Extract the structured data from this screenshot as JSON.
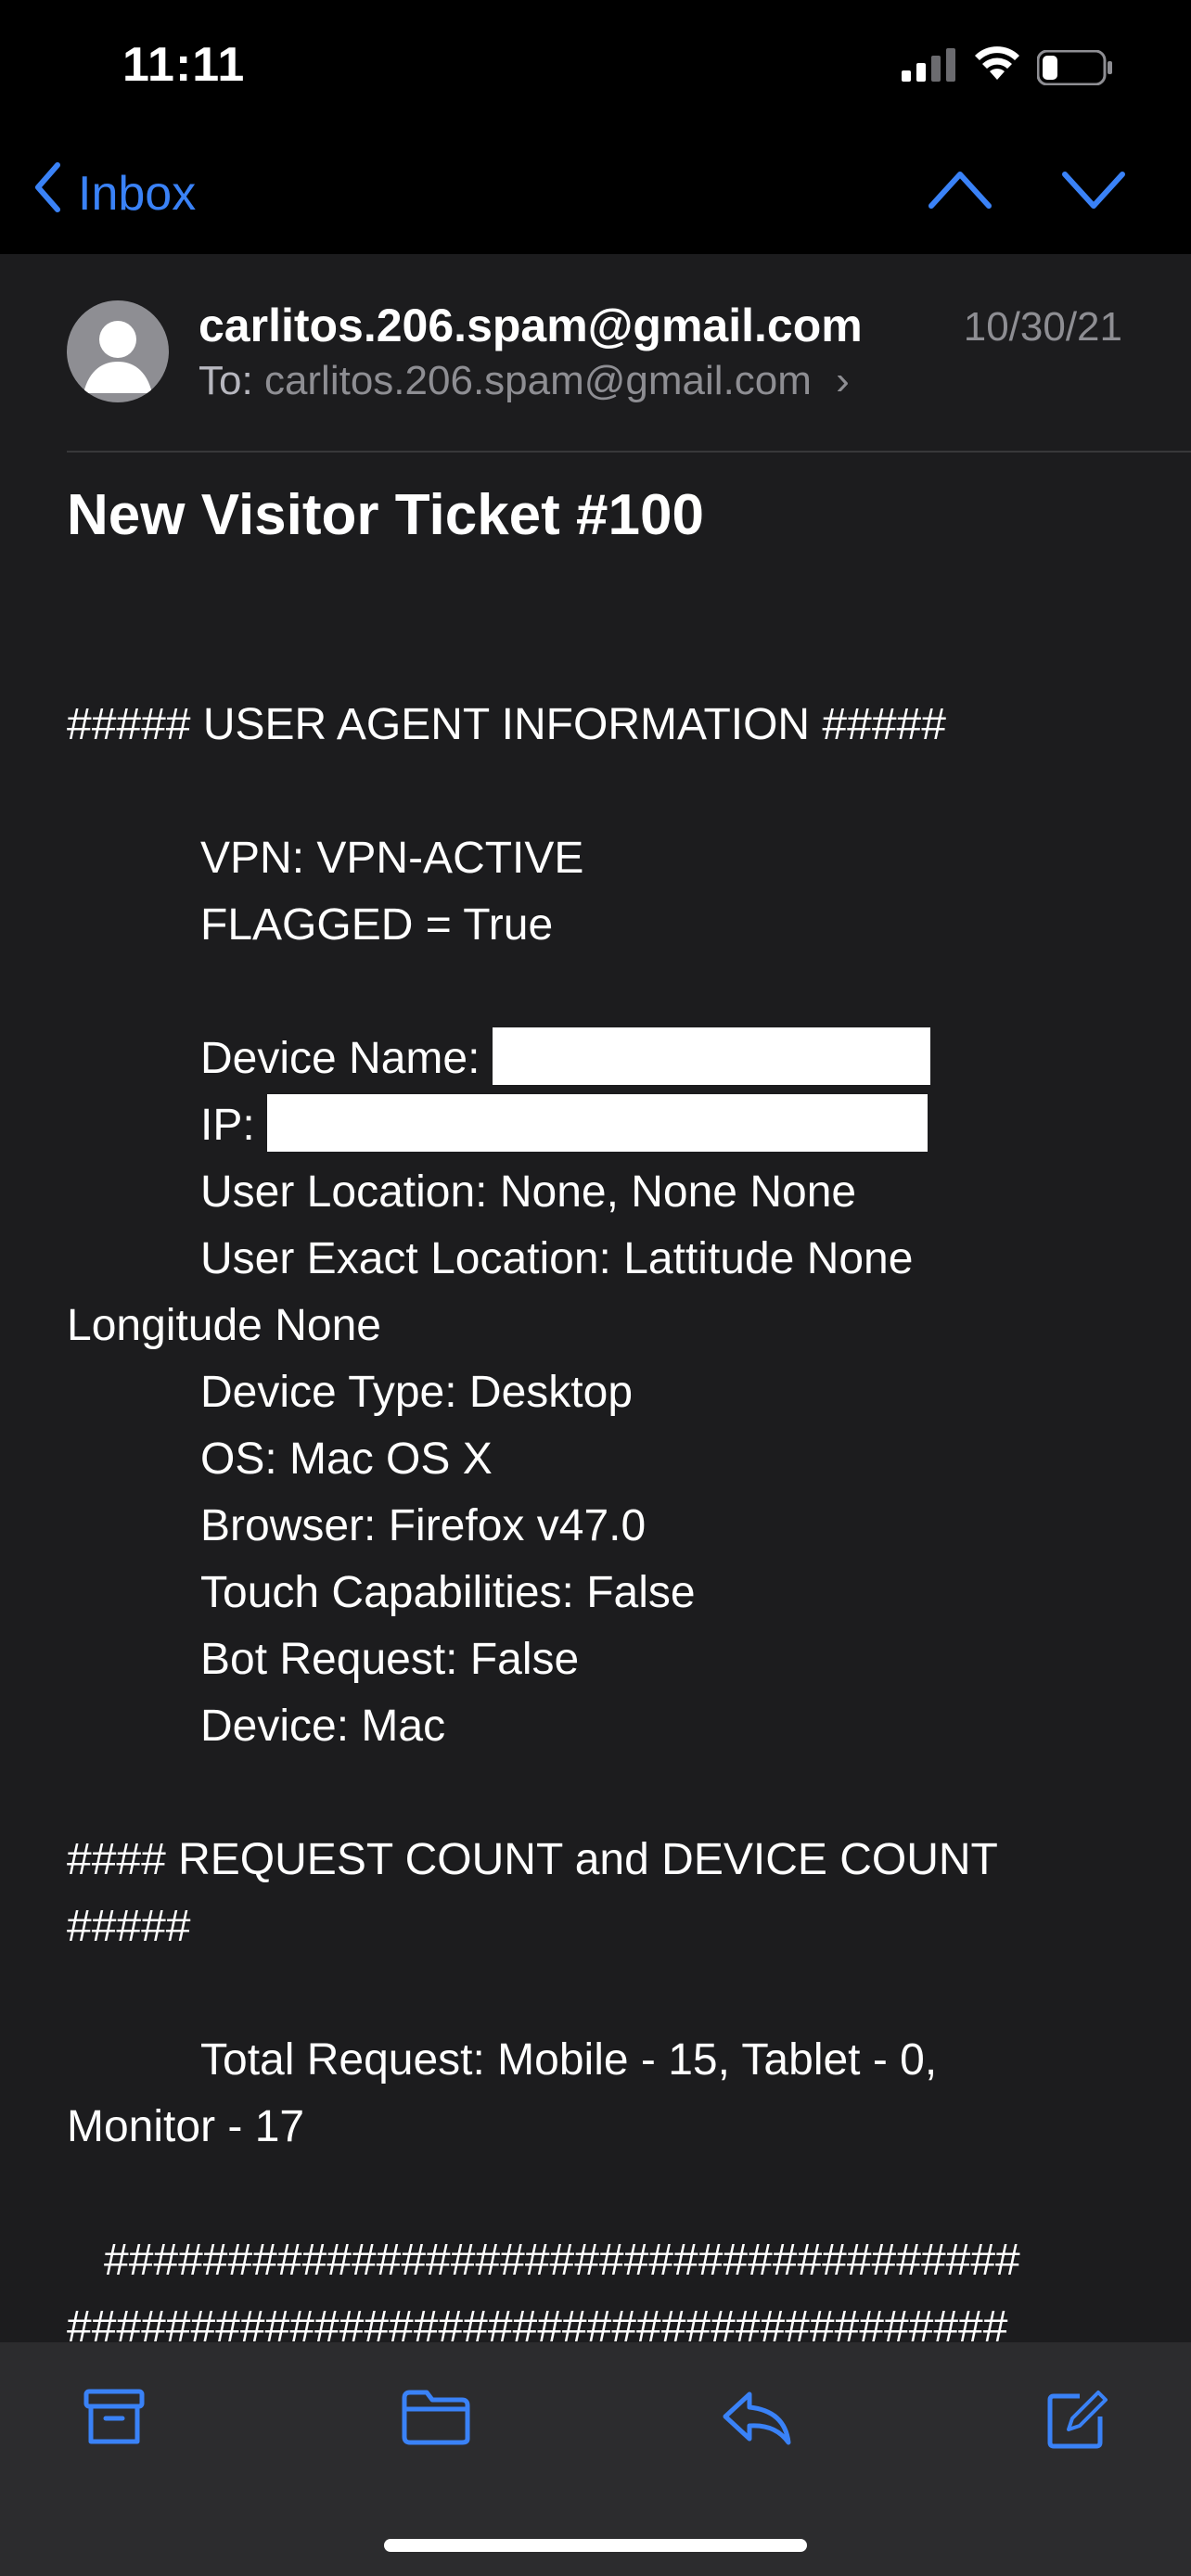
{
  "status": {
    "time": "11:11",
    "icons": [
      "signal-icon",
      "wifi-icon",
      "battery-icon"
    ]
  },
  "nav": {
    "back_label": "Inbox",
    "icons": [
      "chevron-left-icon",
      "chevron-up-icon",
      "chevron-down-icon"
    ]
  },
  "header": {
    "sender": "carlitos.206.spam@gmail.com",
    "to_label": "To:",
    "to_address": "carlitos.206.spam@gmail.com",
    "to_chevron": "›",
    "date": "10/30/21"
  },
  "email": {
    "subject": "New Visitor Ticket #100",
    "lines": {
      "ua_header": "##### USER AGENT INFORMATION #####",
      "vpn": "VPN: VPN-ACTIVE",
      "flagged": "FLAGGED = True",
      "device_name": "Device Name:",
      "ip": "IP:",
      "user_location": "User Location: None, None None",
      "exact_location_1": "User Exact Location: Lattitude None",
      "exact_location_2": "Longitude None",
      "device_type": "Device Type: Desktop",
      "os": "OS: Mac OS X",
      "browser": "Browser: Firefox v47.0",
      "touch": "Touch Capabilities: False",
      "bot": "Bot Request: False",
      "device": "Device: Mac",
      "count_header_1": "#### REQUEST COUNT and DEVICE COUNT",
      "count_header_2": "#####",
      "total_request_1": "Total Request: Mobile - 15, Tablet - 0,",
      "total_request_2": "Monitor - 17",
      "hash_row_1": "#####################################",
      "hash_row_2": "######################################"
    }
  },
  "toolbar": {
    "icons": [
      "archive-icon",
      "folder-icon",
      "reply-icon",
      "compose-icon"
    ]
  },
  "colors": {
    "accent": "#3a82f7",
    "background": "#1c1c1e",
    "secondary_text": "#8e8e93"
  }
}
